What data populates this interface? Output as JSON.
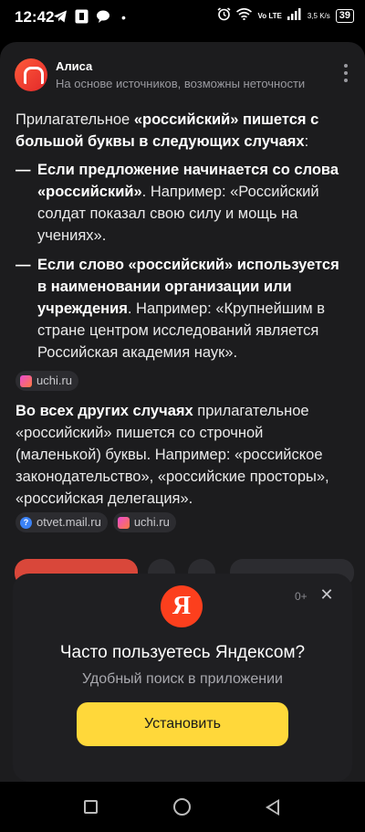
{
  "status_bar": {
    "time": "12:42",
    "network": "Vo LTE",
    "speed": "3,5 K/s",
    "battery": "39"
  },
  "header": {
    "title": "Алиса",
    "subtitle": "На основе источников, возможны неточности"
  },
  "answer": {
    "intro_prefix": "Прилагательное ",
    "intro_bold": "«российский» пишется с большой буквы в следующих случаях",
    "intro_suffix": ":",
    "items": [
      {
        "bold": "Если предложение начинается со слова «российский»",
        "text": ". Например: «Российский солдат показал свою силу и мощь на учениях»."
      },
      {
        "bold": "Если слово «российский» используется в наименовании организации или учреждения",
        "text": ". Например: «Крупнейшим в стране центром исследований является Российская академия наук»."
      }
    ],
    "source1": "uchi.ru",
    "para2_bold": "Во всех других случаях",
    "para2_text": " прилагательное «российский» пишется со строчной (маленькой) буквы. Например: «российское законодательство», «российские просторы», «российская делегация».",
    "source2": "otvet.mail.ru",
    "source3": "uchi.ru"
  },
  "promo": {
    "logo_letter": "Я",
    "age": "0+",
    "close": "✕",
    "title": "Часто пользуетесь Яндексом?",
    "subtitle": "Удобный поиск в приложении",
    "button": "Установить"
  },
  "colors": {
    "accent_yellow": "#ffd83a",
    "yandex_red": "#fc3f1d",
    "card_bg": "#1c1c1e"
  }
}
